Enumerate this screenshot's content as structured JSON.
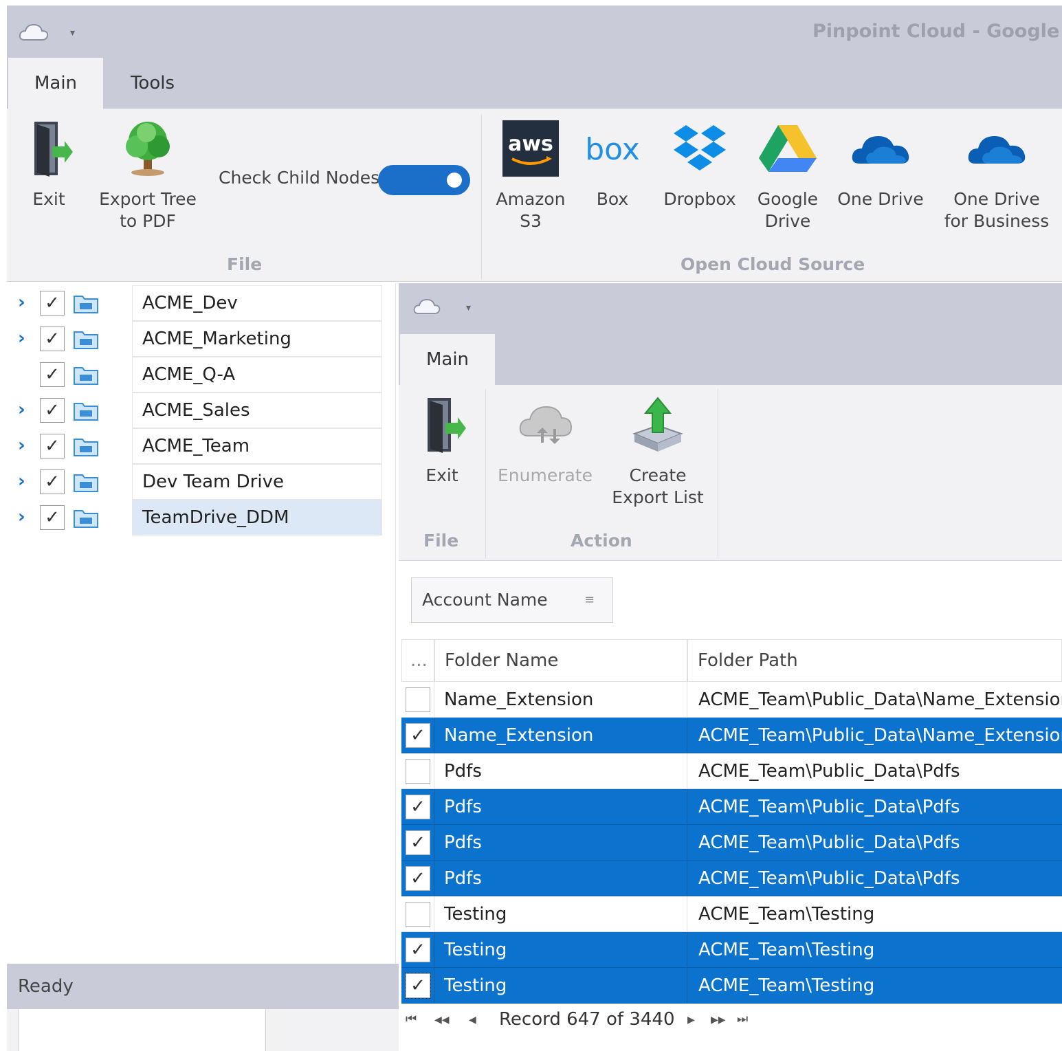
{
  "window": {
    "title": "Pinpoint Cloud - Google Dr"
  },
  "quick_access": {
    "icon": "cloud-icon",
    "caret": "▾"
  },
  "tabs": [
    {
      "label": "Main",
      "active": true
    },
    {
      "label": "Tools",
      "active": false
    }
  ],
  "ribbon": {
    "file_group": {
      "label": "File",
      "exit_label": "Exit",
      "export_tree_label": "Export Tree\nto PDF",
      "check_child_label": "Check Child Nodes",
      "check_child_on": true
    },
    "cloud_group": {
      "label": "Open Cloud Source",
      "items": [
        {
          "label": "Amazon\nS3",
          "icon": "aws-logo",
          "logo_text": "aws"
        },
        {
          "label": "Box",
          "icon": "box-logo",
          "logo_text": "box"
        },
        {
          "label": "Dropbox",
          "icon": "dropbox-logo"
        },
        {
          "label": "Google\nDrive",
          "icon": "google-drive-logo"
        },
        {
          "label": "One Drive",
          "icon": "onedrive-logo"
        },
        {
          "label": "One Drive\nfor Business",
          "icon": "onedrive-business-logo"
        }
      ]
    }
  },
  "tree": {
    "items": [
      {
        "name": "ACME_Dev",
        "expandable": true,
        "checked": true,
        "selected": false
      },
      {
        "name": "ACME_Marketing",
        "expandable": true,
        "checked": true,
        "selected": false
      },
      {
        "name": "ACME_Q-A",
        "expandable": false,
        "checked": true,
        "selected": false
      },
      {
        "name": "ACME_Sales",
        "expandable": true,
        "checked": true,
        "selected": false
      },
      {
        "name": "ACME_Team",
        "expandable": true,
        "checked": true,
        "selected": false
      },
      {
        "name": "Dev Team Drive",
        "expandable": true,
        "checked": true,
        "selected": false
      },
      {
        "name": "TeamDrive_DDM",
        "expandable": true,
        "checked": true,
        "selected": true
      }
    ]
  },
  "status": {
    "text": "Ready"
  },
  "child": {
    "tab_label": "Main",
    "file_group_label": "File",
    "action_group_label": "Action",
    "exit_label": "Exit",
    "enumerate_label": "Enumerate",
    "create_export_label": "Create\nExport List"
  },
  "grid": {
    "group_by": "Account Name",
    "corner": "...",
    "columns": [
      "Folder Name",
      "Folder Path"
    ],
    "rows": [
      {
        "name": "Name_Extension",
        "path": "ACME_Team\\Public_Data\\Name_Extension",
        "checked": false,
        "selected": false
      },
      {
        "name": "Name_Extension",
        "path": "ACME_Team\\Public_Data\\Name_Extension",
        "checked": true,
        "selected": true
      },
      {
        "name": "Pdfs",
        "path": "ACME_Team\\Public_Data\\Pdfs",
        "checked": false,
        "selected": false
      },
      {
        "name": "Pdfs",
        "path": "ACME_Team\\Public_Data\\Pdfs",
        "checked": true,
        "selected": true
      },
      {
        "name": "Pdfs",
        "path": "ACME_Team\\Public_Data\\Pdfs",
        "checked": true,
        "selected": true
      },
      {
        "name": "Pdfs",
        "path": "ACME_Team\\Public_Data\\Pdfs",
        "checked": true,
        "selected": true
      },
      {
        "name": "Testing",
        "path": "ACME_Team\\Testing",
        "checked": false,
        "selected": false
      },
      {
        "name": "Testing",
        "path": "ACME_Team\\Testing",
        "checked": true,
        "selected": true
      },
      {
        "name": "Testing",
        "path": "ACME_Team\\Testing",
        "checked": true,
        "selected": true
      }
    ],
    "navigator": {
      "record_text": "Record 647 of 3440",
      "first": "⏮",
      "prev_page": "◀◀",
      "prev": "◀",
      "next": "▶",
      "next_page": "▶▶",
      "last": "⏭"
    }
  },
  "colors": {
    "accent": "#0b73cd",
    "titlebar": "#c9cbd9",
    "ribbon": "#f2f2f5",
    "selected_tree": "#dce8f5"
  }
}
